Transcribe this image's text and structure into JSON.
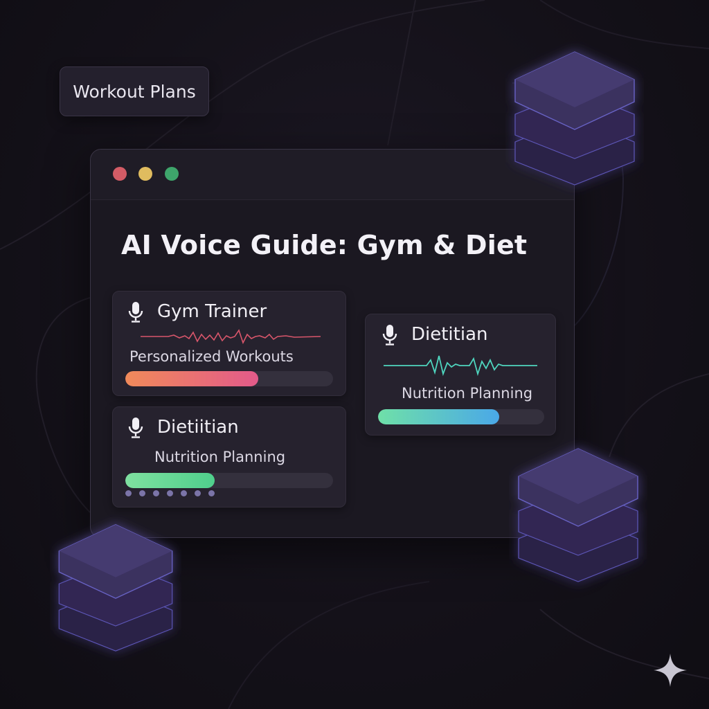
{
  "chip": {
    "label": "Workout Plans"
  },
  "window": {
    "title": "AI Voice Guide: Gym & Diet",
    "controls": [
      "close",
      "minimize",
      "maximize"
    ]
  },
  "cards": [
    {
      "title": "Gym Trainer",
      "subtitle": "Personalized Workouts",
      "icon": "microphone-icon",
      "progress": 0.64,
      "wave_color": "#d9566b",
      "fill_from": "#f08a5a",
      "fill_to": "#e35a8a"
    },
    {
      "title": "Dietiitian",
      "subtitle": "Nutrition Planning",
      "icon": "microphone-icon",
      "progress": 0.43,
      "fill_from": "#7fe0a0",
      "fill_to": "#4fcf8c"
    },
    {
      "title": "Dietitian",
      "subtitle": "Nutrition Planning",
      "icon": "microphone-icon",
      "progress": 0.73,
      "wave_color": "#4fd6bf",
      "fill_from": "#6fe0a8",
      "fill_to": "#4aa8e8"
    }
  ],
  "decor": {
    "cube_color": "#3d3160",
    "cube_glow": "#5a56b8",
    "sparkle_icon": "sparkle-icon"
  }
}
